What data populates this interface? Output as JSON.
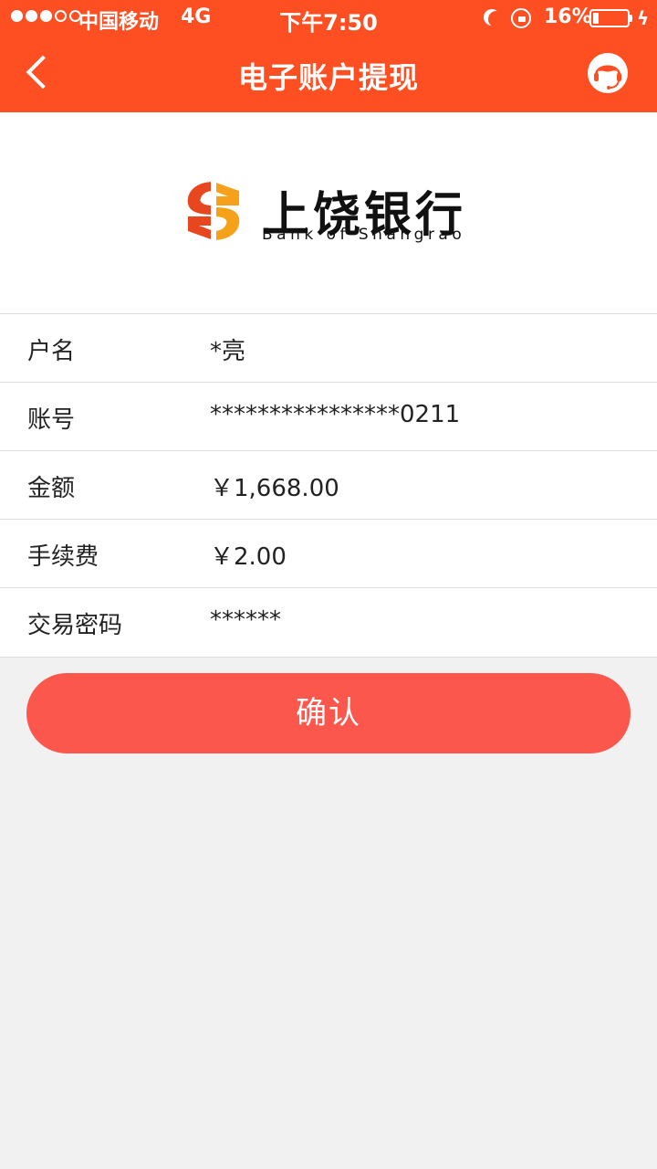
{
  "status_bar": {
    "carrier": "中国移动",
    "network": "4G",
    "time": "下午7:50",
    "battery_percent": "16%",
    "battery_level": 0.16
  },
  "nav": {
    "title": "电子账户提现",
    "back_icon": "chevron-left-icon",
    "service_icon": "customer-service-icon"
  },
  "bank": {
    "name_cn": "上饶银行",
    "name_en": "Bank of Shangrao",
    "logo_colors": [
      "#e8461e",
      "#f6a11a"
    ]
  },
  "rows": [
    {
      "label": "户名",
      "value": "*亮"
    },
    {
      "label": "账号",
      "value": "****************0211"
    },
    {
      "label": "金额",
      "value": "￥1,668.00"
    },
    {
      "label": "手续费",
      "value": "￥2.00"
    },
    {
      "label": "交易密码",
      "value": "******"
    }
  ],
  "confirm": {
    "label": "确认"
  },
  "colors": {
    "header": "#fe4f23",
    "button": "#fc574c",
    "background": "#f1f1f1"
  }
}
